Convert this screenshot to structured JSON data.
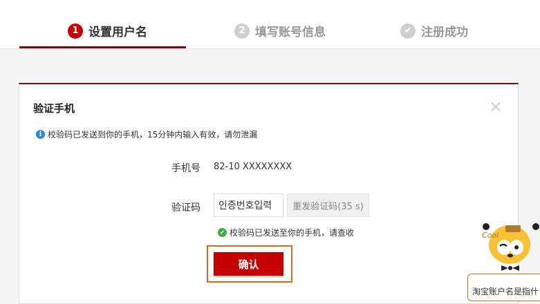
{
  "stepper": {
    "steps": [
      {
        "num": "1",
        "label": "设置用户名",
        "state": "active"
      },
      {
        "num": "2",
        "label": "填写账号信息",
        "state": "inactive"
      },
      {
        "num": "✔",
        "label": "注册成功",
        "state": "inactive"
      }
    ]
  },
  "dialog": {
    "title": "验证手机",
    "close": "×",
    "notice": "校验码已发送到你的手机，15分钟内输入有效，请勿泄漏",
    "phone_label": "手机号",
    "phone_value": "82-10 XXXXXXXX",
    "code_label": "验证码",
    "code_value": "인증번호입력",
    "resend_label": "重发验证码(35 s)",
    "sent_note": "校验码已发送至你的手机，请查收",
    "confirm_label": "确认"
  },
  "mascot": {
    "badge_text": "Cool",
    "tooltip": "淘宝账户名是指什"
  },
  "colors": {
    "brand_red": "#c40000",
    "dark_red": "#8b0000",
    "highlight_orange": "#c8711a"
  }
}
